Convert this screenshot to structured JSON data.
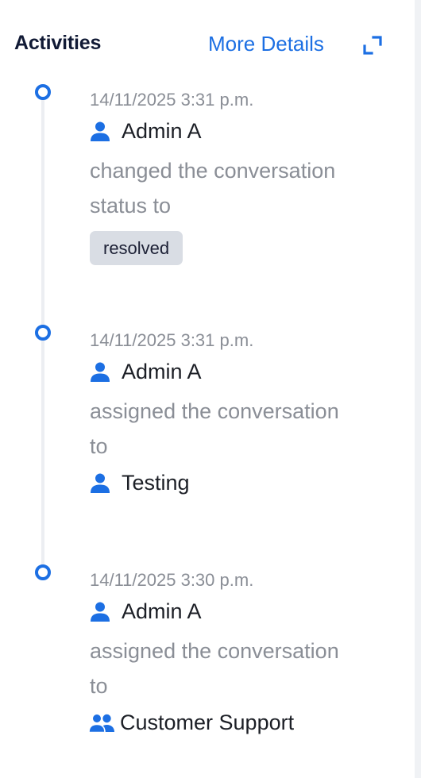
{
  "header": {
    "title": "Activities",
    "more_details_label": "More Details",
    "expand_icon": "expand-icon"
  },
  "colors": {
    "accent": "#1c6fe3",
    "muted_text": "#8a8e96",
    "badge_bg": "#d9dde4"
  },
  "activities": [
    {
      "timestamp": "14/11/2025 3:31 p.m.",
      "actor": "Admin A",
      "actor_icon": "person-icon",
      "action": "changed the conversation status to",
      "status_badge": "resolved"
    },
    {
      "timestamp": "14/11/2025 3:31 p.m.",
      "actor": "Admin A",
      "actor_icon": "person-icon",
      "action": "assigned the conversation to",
      "target": "Testing",
      "target_icon": "person-icon"
    },
    {
      "timestamp": "14/11/2025 3:30 p.m.",
      "actor": "Admin A",
      "actor_icon": "person-icon",
      "action": "assigned the conversation to",
      "target": "Customer Support",
      "target_icon": "group-icon"
    }
  ]
}
